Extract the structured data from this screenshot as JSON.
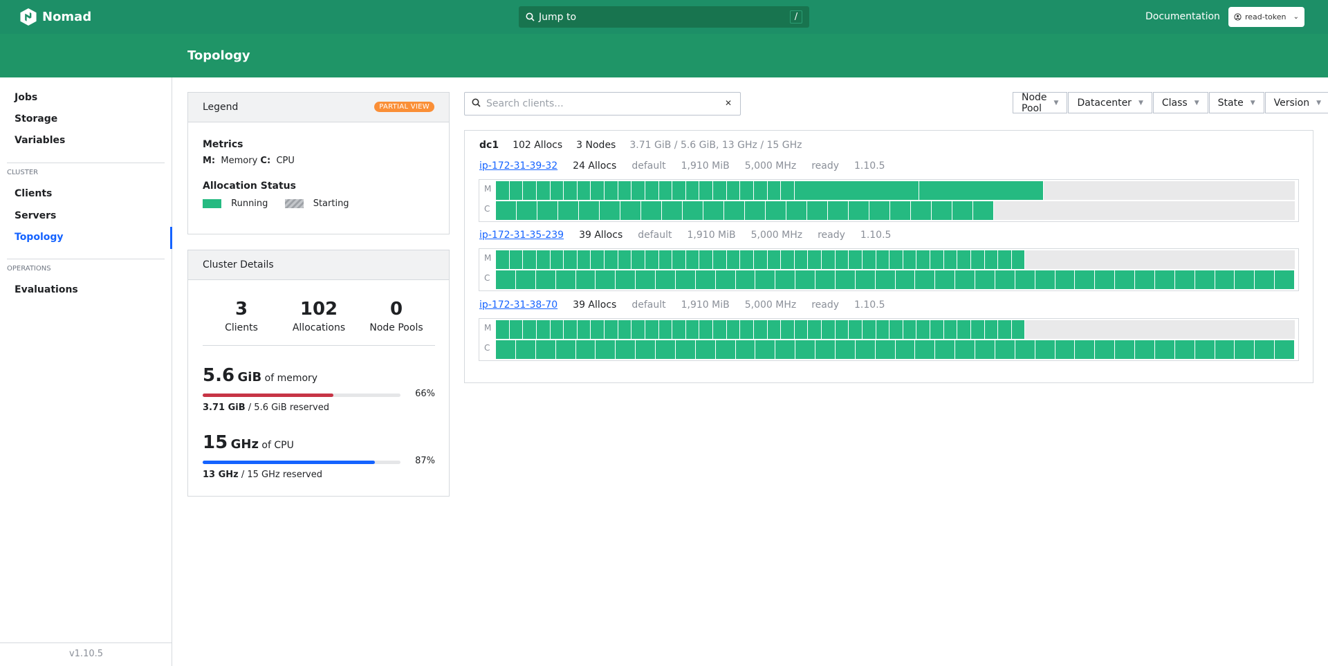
{
  "app": {
    "name": "Nomad",
    "search_label": "Jump to",
    "search_shortcut": "/",
    "doc_link": "Documentation",
    "token": "read-token"
  },
  "page": {
    "title": "Topology"
  },
  "sidebar": {
    "items_top": [
      {
        "label": "Jobs"
      },
      {
        "label": "Storage"
      },
      {
        "label": "Variables"
      }
    ],
    "cluster_label": "CLUSTER",
    "cluster_items": [
      {
        "label": "Clients"
      },
      {
        "label": "Servers"
      },
      {
        "label": "Topology",
        "active": true
      }
    ],
    "operations_label": "OPERATIONS",
    "operations_items": [
      {
        "label": "Evaluations"
      }
    ],
    "version": "v1.10.5"
  },
  "legend": {
    "title": "Legend",
    "badge": "PARTIAL VIEW",
    "metrics_title": "Metrics",
    "m_key": "M:",
    "m_val": "Memory",
    "c_key": "C:",
    "c_val": "CPU",
    "alloc_title": "Allocation Status",
    "running": "Running",
    "starting": "Starting"
  },
  "cluster": {
    "title": "Cluster Details",
    "stats": [
      {
        "value": "3",
        "label": "Clients"
      },
      {
        "value": "102",
        "label": "Allocations"
      },
      {
        "value": "0",
        "label": "Node Pools"
      }
    ],
    "memory": {
      "value": "5.6",
      "unit": "GiB",
      "of": "of memory",
      "percent": 66,
      "percent_label": "66%",
      "used": "3.71 GiB",
      "reserved": "/ 5.6 GiB reserved",
      "color": "#c73445"
    },
    "cpu": {
      "value": "15",
      "unit": "GHz",
      "of": "of CPU",
      "percent": 87,
      "percent_label": "87%",
      "used": "13 GHz",
      "reserved": "/ 15 GHz reserved",
      "color": "#1563ff"
    }
  },
  "search": {
    "placeholder": "Search clients..."
  },
  "filters": [
    {
      "label": "Node Pool"
    },
    {
      "label": "Datacenter"
    },
    {
      "label": "Class"
    },
    {
      "label": "State"
    },
    {
      "label": "Version"
    }
  ],
  "topology": {
    "datacenter": {
      "name": "dc1",
      "allocs": "102 Allocs",
      "nodes": "3 Nodes",
      "usage": "3.71 GiB / 5.6 GiB, 13 GHz / 15 GHz"
    },
    "row_labels": {
      "m": "M",
      "c": "C"
    },
    "nodes": [
      {
        "name": "ip-172-31-39-32",
        "allocs": "24 Allocs",
        "pool": "default",
        "memory": "1,910 MiB",
        "cpu": "5,000 MHz",
        "status": "ready",
        "version": "1.10.5",
        "mem_blocks": [
          1.7,
          1.7,
          1.7,
          1.7,
          1.7,
          1.7,
          1.7,
          1.7,
          1.7,
          1.7,
          1.7,
          1.7,
          1.7,
          1.7,
          1.7,
          1.7,
          1.7,
          1.7,
          1.7,
          1.7,
          1.7,
          1.7,
          15.6,
          15.6
        ],
        "cpu_blocks": [
          2.6,
          2.6,
          2.6,
          2.6,
          2.6,
          2.6,
          2.6,
          2.6,
          2.6,
          2.6,
          2.6,
          2.6,
          2.6,
          2.6,
          2.6,
          2.6,
          2.6,
          2.6,
          2.6,
          2.6,
          2.6,
          2.6,
          2.6,
          2.6
        ]
      },
      {
        "name": "ip-172-31-35-239",
        "allocs": "39 Allocs",
        "pool": "default",
        "memory": "1,910 MiB",
        "cpu": "5,000 MHz",
        "status": "ready",
        "version": "1.10.5",
        "mem_blocks": [
          1.7,
          1.7,
          1.7,
          1.7,
          1.7,
          1.7,
          1.7,
          1.7,
          1.7,
          1.7,
          1.7,
          1.7,
          1.7,
          1.7,
          1.7,
          1.7,
          1.7,
          1.7,
          1.7,
          1.7,
          1.7,
          1.7,
          1.7,
          1.7,
          1.7,
          1.7,
          1.7,
          1.7,
          1.7,
          1.7,
          1.7,
          1.7,
          1.7,
          1.7,
          1.7,
          1.7,
          1.7,
          1.7,
          1.7
        ],
        "cpu_blocks": [
          2.5,
          2.5,
          2.5,
          2.5,
          2.5,
          2.5,
          2.5,
          2.5,
          2.5,
          2.5,
          2.5,
          2.5,
          2.5,
          2.5,
          2.5,
          2.5,
          2.5,
          2.5,
          2.5,
          2.5,
          2.5,
          2.5,
          2.5,
          2.5,
          2.5,
          2.5,
          2.5,
          2.5,
          2.5,
          2.5,
          2.5,
          2.5,
          2.5,
          2.5,
          2.5,
          2.5,
          2.5,
          2.5,
          2.5,
          2.5
        ]
      },
      {
        "name": "ip-172-31-38-70",
        "allocs": "39 Allocs",
        "pool": "default",
        "memory": "1,910 MiB",
        "cpu": "5,000 MHz",
        "status": "ready",
        "version": "1.10.5",
        "mem_blocks": [
          1.7,
          1.7,
          1.7,
          1.7,
          1.7,
          1.7,
          1.7,
          1.7,
          1.7,
          1.7,
          1.7,
          1.7,
          1.7,
          1.7,
          1.7,
          1.7,
          1.7,
          1.7,
          1.7,
          1.7,
          1.7,
          1.7,
          1.7,
          1.7,
          1.7,
          1.7,
          1.7,
          1.7,
          1.7,
          1.7,
          1.7,
          1.7,
          1.7,
          1.7,
          1.7,
          1.7,
          1.7,
          1.7,
          1.7
        ],
        "cpu_blocks": [
          2.5,
          2.5,
          2.5,
          2.5,
          2.5,
          2.5,
          2.5,
          2.5,
          2.5,
          2.5,
          2.5,
          2.5,
          2.5,
          2.5,
          2.5,
          2.5,
          2.5,
          2.5,
          2.5,
          2.5,
          2.5,
          2.5,
          2.5,
          2.5,
          2.5,
          2.5,
          2.5,
          2.5,
          2.5,
          2.5,
          2.5,
          2.5,
          2.5,
          2.5,
          2.5,
          2.5,
          2.5,
          2.5,
          2.5,
          2.5
        ]
      }
    ]
  }
}
